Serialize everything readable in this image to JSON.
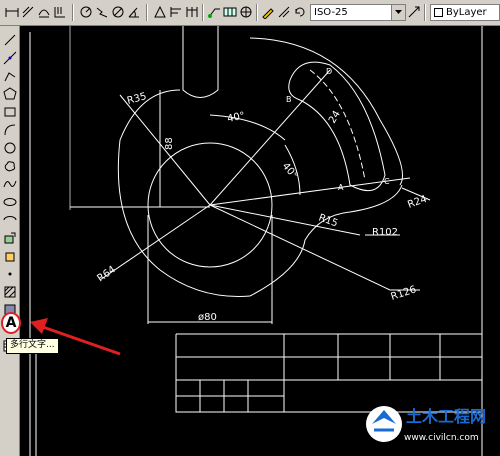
{
  "toolbar": {
    "dimstyle_value": "ISO-25",
    "layer_value": "ByLayer"
  },
  "drawing": {
    "labels": {
      "r35": "R35",
      "dim88": "88",
      "ang40a": "40°",
      "ang40b": "40°",
      "dim24": "24",
      "r24": "R24",
      "r15": "R15",
      "r102": "R102",
      "r64": "R64",
      "r126": "R126",
      "dia80": "ø80",
      "pa": "A",
      "pb": "B",
      "pc": "C",
      "pd": "D"
    }
  },
  "tooltip": {
    "text": "多行文字..."
  },
  "mtext_button": {
    "label": "A"
  },
  "watermark": {
    "title": "土木工程网",
    "url": "www.civilcn.com"
  },
  "colors": {
    "canvas": "#000000",
    "lines": "#ffffff",
    "highlight": "#e02020",
    "watermark": "#1a6bd1"
  }
}
